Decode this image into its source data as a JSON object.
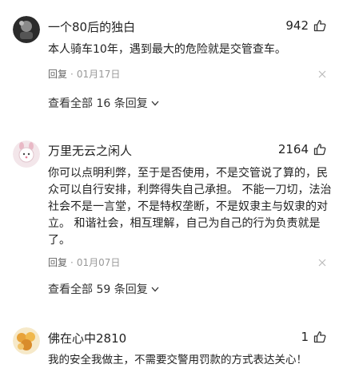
{
  "comments": [
    {
      "user": "一个80后的独白",
      "likes": "942",
      "text": "本人骑车10年，遇到最大的危险就是交管查车。",
      "reply_label": "回复",
      "date": "01月17日",
      "view_replies": "查看全部 16 条回复"
    },
    {
      "user": "万里无云之闲人",
      "likes": "2164",
      "text": "你可以点明利弊，至于是否使用，不是交管说了算的，民众可以自行安排，利弊得失自己承担。 不能一刀切，法治社会不是一言堂，不是特权垄断，不是奴隶主与奴隶的对立。 和谐社会，相互理解，自己为自己的行为负责就是了。",
      "reply_label": "回复",
      "date": "01月07日",
      "view_replies": "查看全部 59 条回复"
    },
    {
      "user": "佛在心中2810",
      "likes": "1",
      "text": "我的安全我做主，不需要交警用罚款的方式表达关心！"
    }
  ],
  "meta_separator": "·",
  "icons": {
    "like": "thumbs-up-icon",
    "dismiss": "close-icon",
    "expand": "chevron-down-icon"
  },
  "colors": {
    "text": "#222222",
    "meta": "#999999",
    "background": "#ffffff"
  }
}
